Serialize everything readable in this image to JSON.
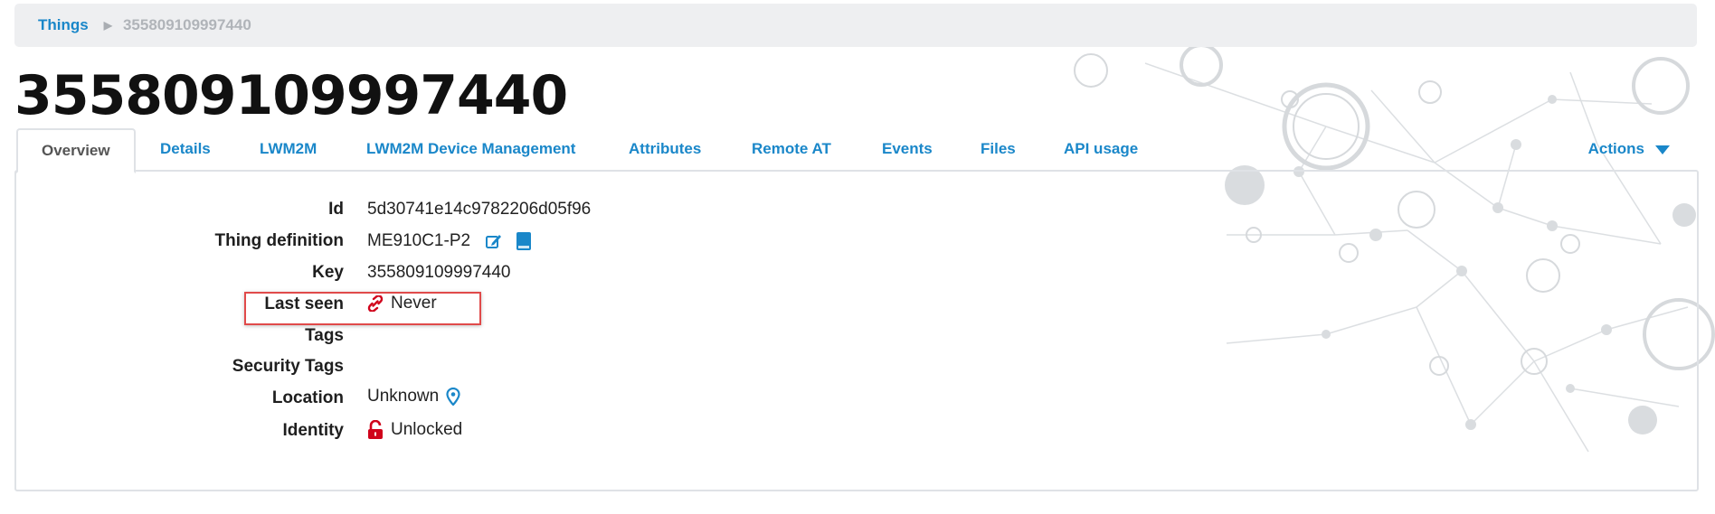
{
  "breadcrumb": {
    "root_label": "Things",
    "current_label": "355809109997440"
  },
  "page": {
    "title": "355809109997440"
  },
  "tabs": [
    {
      "label": "Overview",
      "active": true
    },
    {
      "label": "Details"
    },
    {
      "label": "LWM2M"
    },
    {
      "label": "LWM2M Device Management"
    },
    {
      "label": "Attributes"
    },
    {
      "label": "Remote AT"
    },
    {
      "label": "Events"
    },
    {
      "label": "Files"
    },
    {
      "label": "API usage"
    }
  ],
  "actions": {
    "label": "Actions"
  },
  "fields": {
    "id": {
      "label": "Id",
      "value": "5d30741e14c9782206d05f96"
    },
    "thing_definition": {
      "label": "Thing definition",
      "value": "ME910C1-P2"
    },
    "key": {
      "label": "Key",
      "value": "355809109997440"
    },
    "last_seen": {
      "label": "Last seen",
      "value": "Never"
    },
    "tags": {
      "label": "Tags",
      "value": ""
    },
    "security_tags": {
      "label": "Security Tags",
      "value": ""
    },
    "location": {
      "label": "Location",
      "value": "Unknown"
    },
    "identity": {
      "label": "Identity",
      "value": "Unlocked"
    }
  },
  "colors": {
    "link": "#1a87c9",
    "danger": "#d0021b",
    "highlight_border": "#e04a4a"
  },
  "icons": {
    "edit": "edit-icon",
    "book": "book-icon",
    "link_broken": "broken-link-icon",
    "location_pin": "map-pin-icon",
    "lock_open": "unlock-icon"
  }
}
